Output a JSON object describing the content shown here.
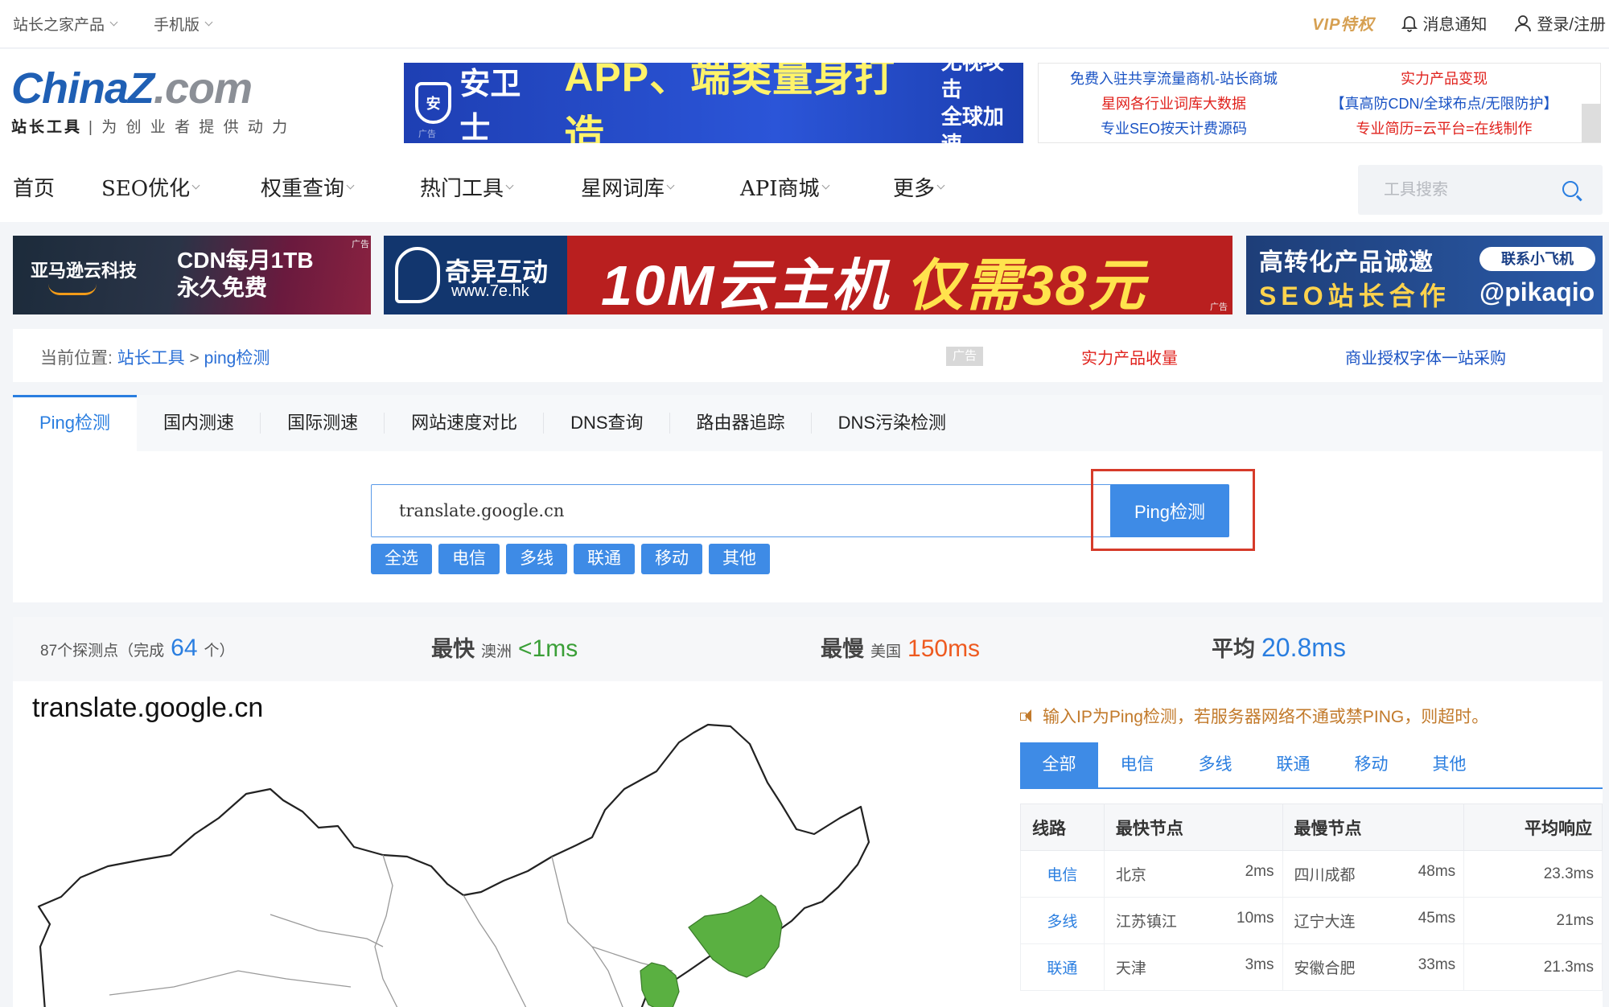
{
  "topbar": {
    "products": "站长之家产品",
    "mobile": "手机版",
    "vip": "VIP特权",
    "notify": "消息通知",
    "login": "登录/注册"
  },
  "logo": {
    "word_a": "China",
    "word_b": "Z",
    "word_c": ".com",
    "sub_bold": "站长工具",
    "sub": "| 为 创 业 者 提 供 动 力"
  },
  "banner": {
    "shield": "安",
    "brand": "安卫士",
    "headline": "APP、端类量身打造",
    "side_top": "无视攻击",
    "side_bottom": "全球加速",
    "tag": "广告"
  },
  "text_ads": [
    {
      "text": "免费入驻共享流量商机-站长商城",
      "color": "blue"
    },
    {
      "text": "实力产品变现",
      "color": "red"
    },
    {
      "text": "星网各行业词库大数据",
      "color": "red"
    },
    {
      "text": "【真高防CDN/全球布点/无限防护】",
      "color": "blue"
    },
    {
      "text": "专业SEO按天计费源码",
      "color": "blue"
    },
    {
      "text": "专业简历=云平台=在线制作",
      "color": "red"
    }
  ],
  "nav": [
    "首页",
    "SEO优化",
    "权重查询",
    "热门工具",
    "星网词库",
    "API商城",
    "更多"
  ],
  "search": {
    "placeholder": "工具搜索"
  },
  "ads_row": {
    "ad1_brand": "亚马逊云科技",
    "ad1_l1": "CDN每月1TB",
    "ad1_l2": "永久免费",
    "ad2_name": "奇异互动",
    "ad2_url": "www.7e.hk",
    "ad2_big_a": "10M云主机",
    "ad2_big_b": " 仅需38元",
    "ad3_l1": "高转化产品诚邀",
    "ad3_l2": "SEO站长合作",
    "ad3_fly": "联系小飞机",
    "ad3_handle": "@pikaqio",
    "tag": "广告"
  },
  "breadcrumb": {
    "label": "当前位置:",
    "home": "站长工具",
    "sep": ">",
    "current": "ping检测",
    "ad": "广告",
    "link1": "实力产品收量",
    "link2": "商业授权字体一站采购"
  },
  "tabs": [
    "Ping检测",
    "国内测速",
    "国际测速",
    "网站速度对比",
    "DNS查询",
    "路由器追踪",
    "DNS污染检测"
  ],
  "form": {
    "domain": "translate.google.cn",
    "button": "Ping检测",
    "chips": [
      "全选",
      "电信",
      "多线",
      "联通",
      "移动",
      "其他"
    ]
  },
  "stats": {
    "nodes_prefix": "87个探测点（完成",
    "done": "64",
    "nodes_suffix": "个）",
    "fast_label": "最快",
    "fast_loc": "澳洲",
    "fast_val": "<1ms",
    "slow_label": "最慢",
    "slow_loc": "美国",
    "slow_val": "150ms",
    "avg_label": "平均",
    "avg_val": "20.8ms"
  },
  "map": {
    "title": "translate.google.cn"
  },
  "notice": "输入IP为Ping检测，若服务器网络不通或禁PING，则超时。",
  "filter_tabs": [
    "全部",
    "电信",
    "多线",
    "联通",
    "移动",
    "其他"
  ],
  "table": {
    "headers": [
      "线路",
      "最快节点",
      "最慢节点",
      "平均响应"
    ],
    "rows": [
      {
        "line": "电信",
        "fast": "北京",
        "fast_ms": "2ms",
        "slow": "四川成都",
        "slow_ms": "48ms",
        "avg": "23.3ms"
      },
      {
        "line": "多线",
        "fast": "江苏镇江",
        "fast_ms": "10ms",
        "slow": "辽宁大连",
        "slow_ms": "45ms",
        "avg": "21ms"
      },
      {
        "line": "联通",
        "fast": "天津",
        "fast_ms": "3ms",
        "slow": "安徽合肥",
        "slow_ms": "33ms",
        "avg": "21.3ms"
      }
    ]
  },
  "colors": {
    "accent": "#3e8be6",
    "fast": "#3a9f37",
    "slow": "#ee5a20",
    "highlight_box": "#d63b2a",
    "map_fill": "#5ab041"
  }
}
